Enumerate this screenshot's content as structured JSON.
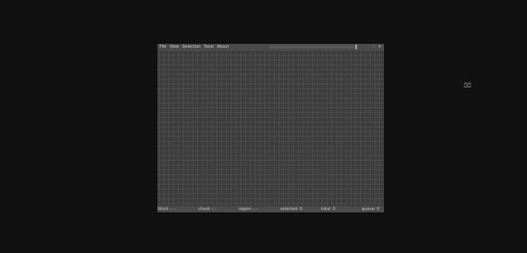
{
  "menu": {
    "items": [
      "File",
      "View",
      "Selection",
      "Tools",
      "About"
    ]
  },
  "toolbar": {
    "icons": [
      "grip-icon",
      "layers-icon",
      "settings-icon"
    ]
  },
  "status": {
    "block": "block -, -",
    "chunk": "chunk -, -",
    "region": "region -, -",
    "selected": "selected: 0",
    "total": "total: 0",
    "queue": "queue: 0"
  },
  "colors": {
    "background": "#111111",
    "canvas": "#3d3d3d",
    "grid": "#4b4b4b",
    "bar": "#4a4a4a",
    "text": "#cfcfcf"
  }
}
